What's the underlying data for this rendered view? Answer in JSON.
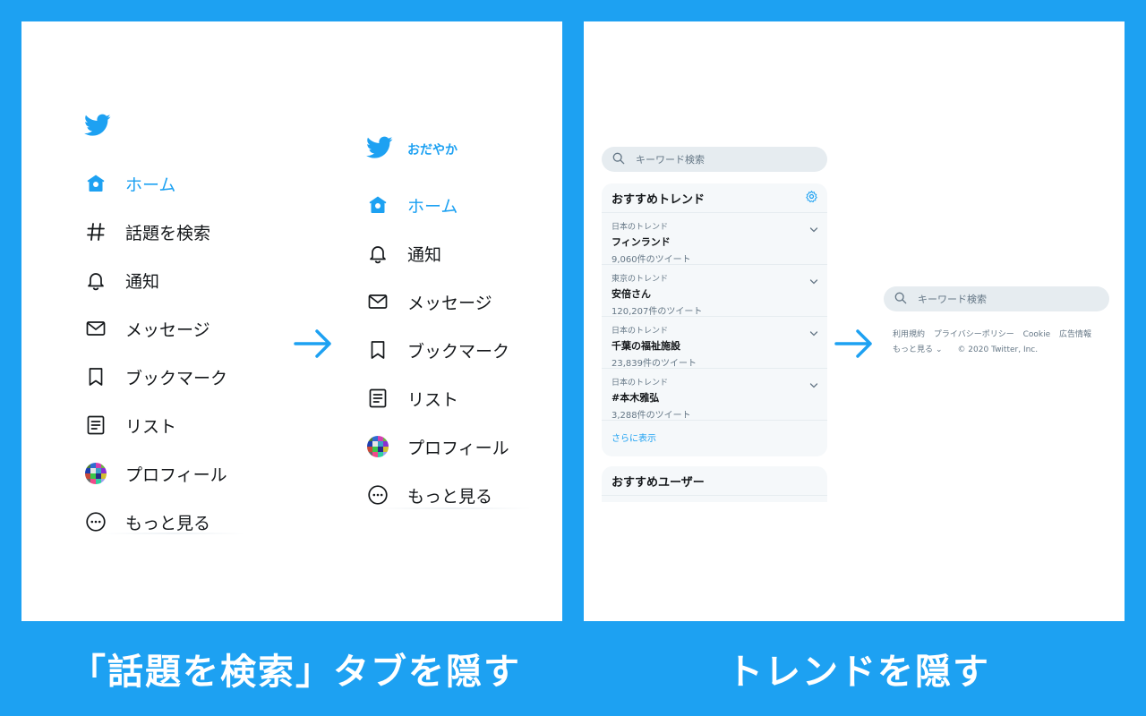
{
  "colors": {
    "accent": "#1da1f2",
    "background": "#1da1f2",
    "panel": "#ffffff",
    "text": "#14171a",
    "muted": "#657786"
  },
  "captions": {
    "left": "「話題を検索」タブを隠す",
    "right": "トレンドを隠す"
  },
  "nav_before": {
    "logo_icon": "twitter-bird-icon",
    "items": [
      {
        "label": "ホーム",
        "icon": "home-icon",
        "active": true
      },
      {
        "label": "話題を検索",
        "icon": "hashtag-icon",
        "active": false
      },
      {
        "label": "通知",
        "icon": "bell-icon",
        "active": false
      },
      {
        "label": "メッセージ",
        "icon": "envelope-icon",
        "active": false
      },
      {
        "label": "ブックマーク",
        "icon": "bookmark-icon",
        "active": false
      },
      {
        "label": "リスト",
        "icon": "list-icon",
        "active": false
      },
      {
        "label": "プロフィール",
        "icon": "avatar",
        "active": false
      },
      {
        "label": "もっと見る",
        "icon": "more-icon",
        "active": false
      }
    ]
  },
  "nav_after": {
    "logo_icon": "twitter-bird-icon",
    "account_name": "おだやか",
    "items": [
      {
        "label": "ホーム",
        "icon": "home-icon",
        "active": true
      },
      {
        "label": "通知",
        "icon": "bell-icon",
        "active": false
      },
      {
        "label": "メッセージ",
        "icon": "envelope-icon",
        "active": false
      },
      {
        "label": "ブックマーク",
        "icon": "bookmark-icon",
        "active": false
      },
      {
        "label": "リスト",
        "icon": "list-icon",
        "active": false
      },
      {
        "label": "プロフィール",
        "icon": "avatar",
        "active": false
      },
      {
        "label": "もっと見る",
        "icon": "more-icon",
        "active": false
      }
    ]
  },
  "search": {
    "placeholder": "キーワード検索"
  },
  "trends": {
    "title": "おすすめトレンド",
    "items": [
      {
        "context": "日本のトレンド",
        "name": "フィンランド",
        "count": "9,060件のツイート"
      },
      {
        "context": "東京のトレンド",
        "name": "安倍さん",
        "count": "120,207件のツイート"
      },
      {
        "context": "日本のトレンド",
        "name": "千葉の福祉施設",
        "count": "23,839件のツイート"
      },
      {
        "context": "日本のトレンド",
        "name": "#本木雅弘",
        "count": "3,288件のツイート"
      }
    ],
    "show_more": "さらに表示"
  },
  "users": {
    "title": "おすすめユーザー"
  },
  "footer": {
    "links": [
      "利用規約",
      "プライバシーポリシー",
      "Cookie",
      "広告情報"
    ],
    "more": "もっと見る",
    "copyright": "© 2020 Twitter, Inc."
  }
}
